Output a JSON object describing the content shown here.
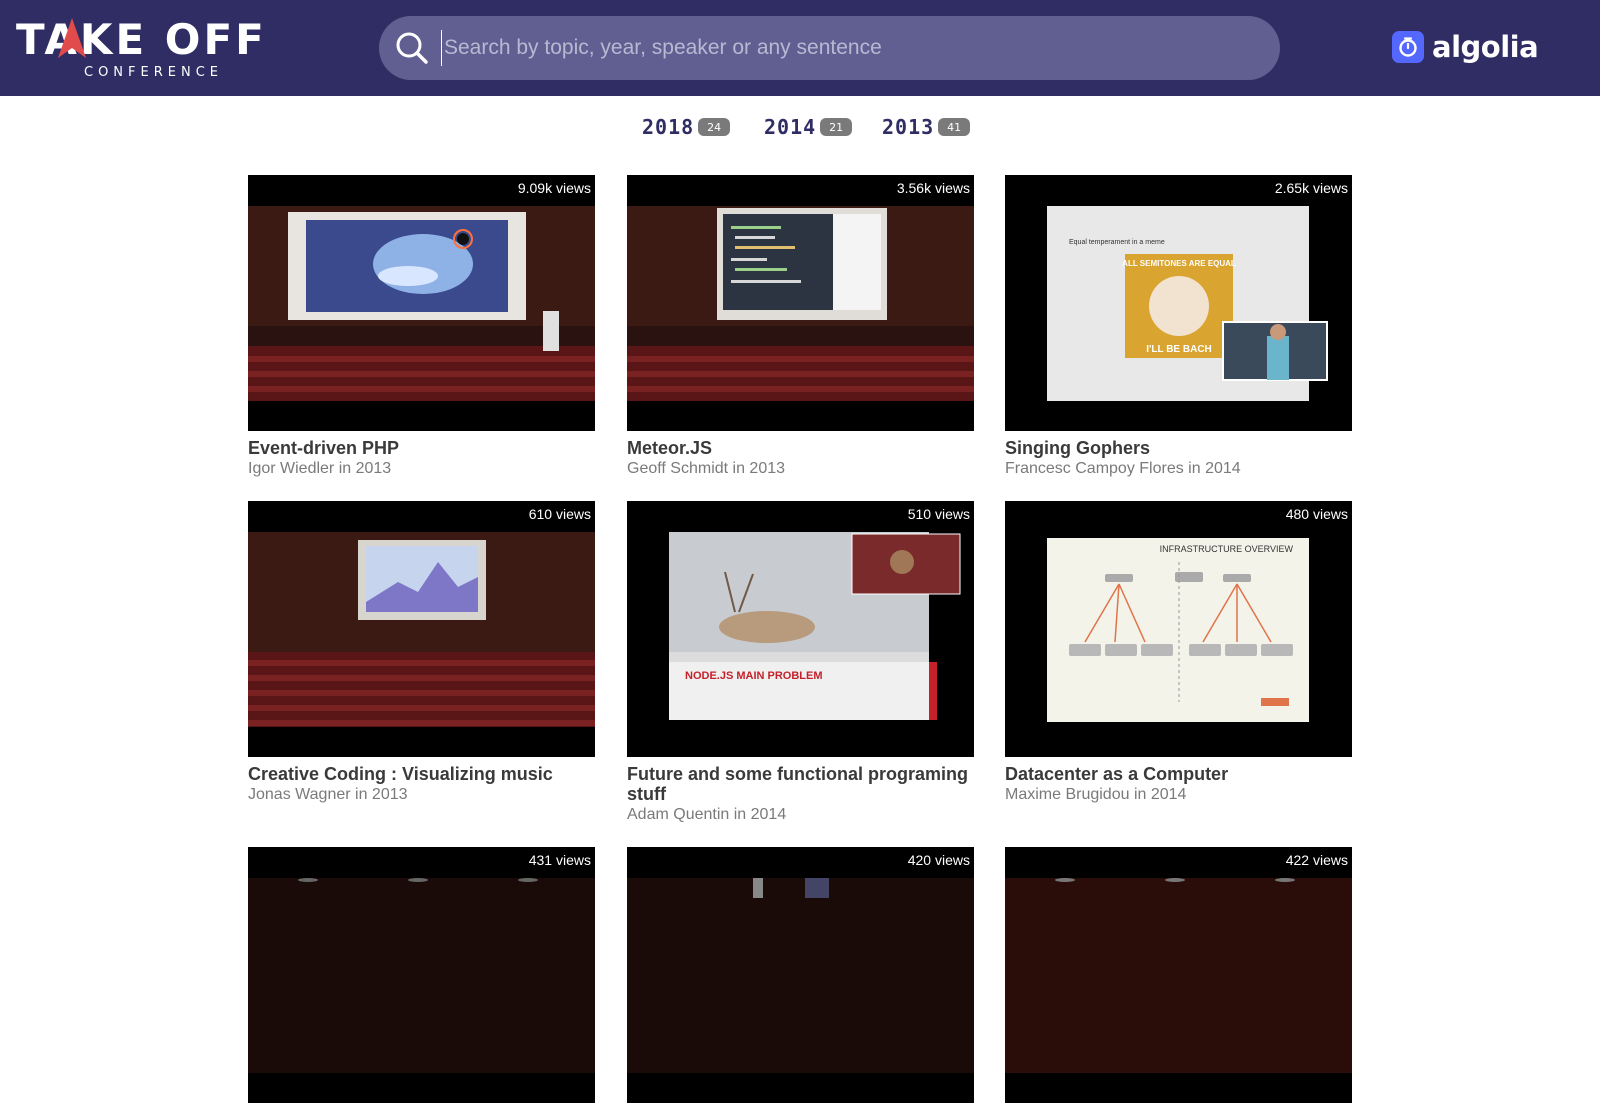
{
  "header": {
    "logo_main": "TAKE OFF",
    "logo_sub": "CONFERENCE",
    "search": {
      "placeholder": "Search by topic, year, speaker or any sentence",
      "value": ""
    },
    "algolia_label": "algolia"
  },
  "years": [
    {
      "label": "2018",
      "count": "24"
    },
    {
      "label": "2014",
      "count": "21"
    },
    {
      "label": "2013",
      "count": "41"
    }
  ],
  "talks": [
    {
      "views": "9.09k views",
      "title": "Event-driven PHP",
      "meta": "Igor Wiedler in 2013",
      "thumb": "auditorium-galaxy"
    },
    {
      "views": "3.56k views",
      "title": "Meteor.JS",
      "meta": "Geoff Schmidt in 2013",
      "thumb": "auditorium-code"
    },
    {
      "views": "2.65k views",
      "title": "Singing Gophers",
      "meta": "Francesc Campoy Flores in 2014",
      "thumb": "slide-bach",
      "slide_caption_top": "ALL SEMITONES ARE EQUAL",
      "slide_caption_bottom": "I'LL BE BACH",
      "slide_heading": "Equal temperament in a meme"
    },
    {
      "views": "610 views",
      "title": "Creative Coding : Visualizing music",
      "meta": "Jonas Wagner in 2013",
      "thumb": "auditorium-music"
    },
    {
      "views": "510 views",
      "title": "Future and some functional programing stuff",
      "meta": "Adam Quentin in 2014",
      "thumb": "slide-deer",
      "slide_caption": "NODE.JS MAIN PROBLEM"
    },
    {
      "views": "480 views",
      "title": "Datacenter as a Computer",
      "meta": "Maxime Brugidou in 2014",
      "thumb": "slide-infra",
      "slide_heading": "INFRASTRUCTURE OVERVIEW"
    },
    {
      "views": "431 views",
      "title": "",
      "meta": "",
      "thumb": "dark"
    },
    {
      "views": "420 views",
      "title": "",
      "meta": "",
      "thumb": "dark"
    },
    {
      "views": "422 views",
      "title": "",
      "meta": "",
      "thumb": "dark"
    }
  ],
  "colors": {
    "header_bg": "#2f2d64",
    "search_bg": "#615f92",
    "algolia_blue": "#5468ff"
  }
}
